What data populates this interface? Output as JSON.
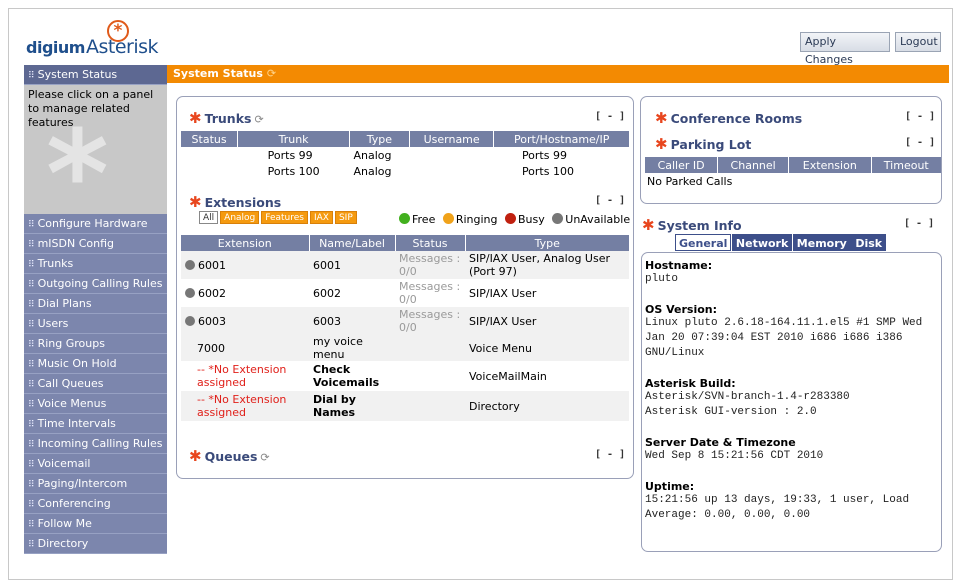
{
  "header": {
    "logo_digium": "digium",
    "logo_asterisk": "Asterisk",
    "apply_label": "Apply Changes",
    "logout_label": "Logout"
  },
  "sidebar": {
    "info": "Please click on a panel to manage related features",
    "first": "System Status",
    "items": [
      "Configure Hardware",
      "mISDN Config",
      "Trunks",
      "Outgoing Calling Rules",
      "Dial Plans",
      "Users",
      "Ring Groups",
      "Music On Hold",
      "Call Queues",
      "Voice Menus",
      "Time Intervals",
      "Incoming Calling Rules",
      "Voicemail",
      "Paging/Intercom",
      "Conferencing",
      "Follow Me",
      "Directory"
    ]
  },
  "title": "System Status",
  "collapse": "[ - ]",
  "trunks": {
    "title": "Trunks",
    "headers": [
      "Status",
      "Trunk",
      "Type",
      "Username",
      "Port/Hostname/IP"
    ],
    "rows": [
      [
        "",
        "Ports 99",
        "Analog",
        "",
        "Ports 99"
      ],
      [
        "",
        "Ports 100",
        "Analog",
        "",
        "Ports 100"
      ]
    ]
  },
  "extensions": {
    "title": "Extensions",
    "filters": [
      "All",
      "Analog",
      "Features",
      "IAX",
      "SIP"
    ],
    "legend": [
      "Free",
      "Ringing",
      "Busy",
      "UnAvailable"
    ],
    "headers": [
      "Extension",
      "Name/Label",
      "Status",
      "Type"
    ],
    "rows": [
      {
        "ext": "6001",
        "name": "6001",
        "status": "Messages : 0/0",
        "type": "SIP/IAX User, Analog User (Port 97)"
      },
      {
        "ext": "6002",
        "name": "6002",
        "status": "Messages : 0/0",
        "type": "SIP/IAX User"
      },
      {
        "ext": "6003",
        "name": "6003",
        "status": "Messages : 0/0",
        "type": "SIP/IAX User"
      },
      {
        "ext": "7000",
        "name": "my voice menu",
        "status": "",
        "type": "Voice Menu"
      },
      {
        "ext": "-- *No Extension assigned",
        "name": "Check Voicemails",
        "status": "",
        "type": "VoiceMailMain"
      },
      {
        "ext": "-- *No Extension assigned",
        "name": "Dial by Names",
        "status": "",
        "type": "Directory"
      }
    ]
  },
  "queues": {
    "title": "Queues"
  },
  "conference": {
    "title": "Conference Rooms"
  },
  "parking": {
    "title": "Parking Lot",
    "headers": [
      "Caller ID",
      "Channel",
      "Extension",
      "Timeout"
    ],
    "empty": "No Parked Calls"
  },
  "sysinfo": {
    "title": "System Info",
    "tabs": [
      "General",
      "Network",
      "Memory",
      "Disk"
    ],
    "hostname_label": "Hostname:",
    "hostname": "pluto",
    "os_label": "OS Version:",
    "os": "Linux pluto 2.6.18-164.11.1.el5 #1 SMP Wed Jan 20 07:39:04 EST 2010 i686 i686 i386 GNU/Linux",
    "build_label": "Asterisk Build:",
    "build1": "Asterisk/SVN-branch-1.4-r283380",
    "build2": "Asterisk GUI-version : 2.0",
    "date_label": "Server Date & Timezone",
    "date": "Wed Sep 8 15:21:56 CDT 2010",
    "uptime_label": "Uptime:",
    "uptime": "15:21:56 up 13 days, 19:33, 1 user, Load Average: 0.00, 0.00, 0.00"
  },
  "colors": {
    "orange": "#f38a02",
    "nav": "#7c86ad",
    "header": "#747fa3",
    "star": "#e8461e"
  }
}
